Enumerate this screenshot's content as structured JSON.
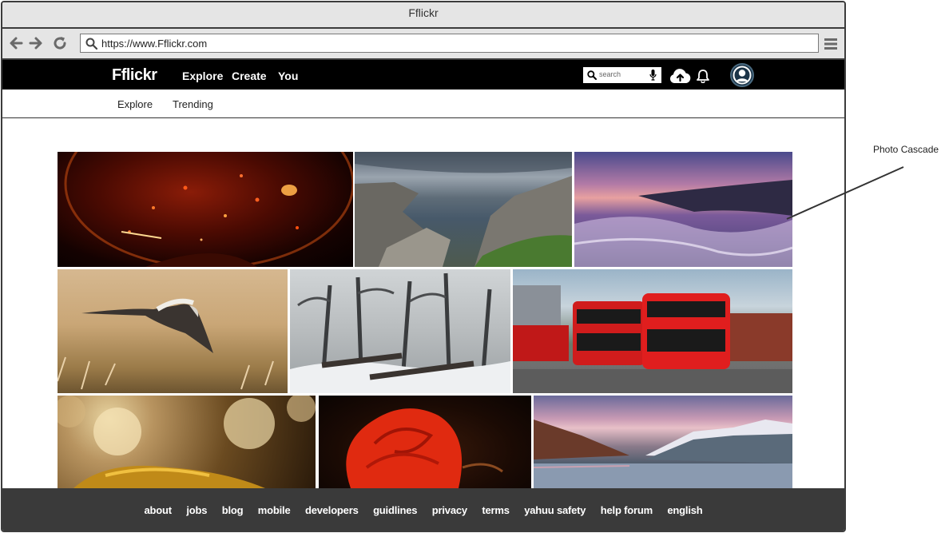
{
  "window": {
    "title": "Fflickr"
  },
  "browser": {
    "url": "https://www.Fflickr.com"
  },
  "app": {
    "logo": "Fflickr",
    "nav": [
      {
        "label": "Explore"
      },
      {
        "label": "Create"
      },
      {
        "label": "You"
      }
    ],
    "search": {
      "placeholder": "search"
    },
    "subnav": [
      {
        "label": "Explore"
      },
      {
        "label": "Trending"
      }
    ]
  },
  "photos": [
    {
      "subject": "wine glass with bokeh lights"
    },
    {
      "subject": "rocky coast under long-exposure sky"
    },
    {
      "subject": "purple sunset waves on rocks"
    },
    {
      "subject": "bird in flight over dry grass"
    },
    {
      "subject": "snowy misty forest"
    },
    {
      "subject": "red double-decker buses"
    },
    {
      "subject": "golden bokeh object"
    },
    {
      "subject": "red rose"
    },
    {
      "subject": "mountain lake at dusk"
    }
  ],
  "footer": {
    "links": [
      {
        "label": "about"
      },
      {
        "label": "jobs"
      },
      {
        "label": "blog"
      },
      {
        "label": "mobile"
      },
      {
        "label": "developers"
      },
      {
        "label": "guidlines"
      },
      {
        "label": "privacy"
      },
      {
        "label": "terms"
      },
      {
        "label": "yahuu safety"
      },
      {
        "label": "help forum"
      },
      {
        "label": "english"
      }
    ]
  },
  "annotation": {
    "label": "Photo Cascade"
  },
  "icons": {
    "back": "arrow-left-icon",
    "forward": "arrow-right-icon",
    "reload": "reload-icon",
    "search": "search-icon",
    "menu": "hamburger-icon",
    "mic": "microphone-icon",
    "upload": "cloud-upload-icon",
    "notifications": "bell-icon",
    "avatar": "user-avatar-icon"
  },
  "colors": {
    "topnav": "#000000",
    "footer": "#3a3a3a",
    "chrome": "#e5e5e5"
  }
}
